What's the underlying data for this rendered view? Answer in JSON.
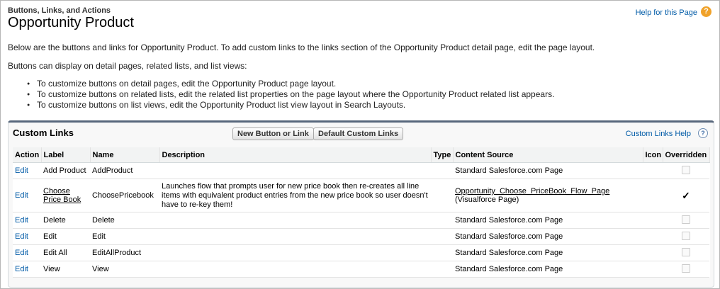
{
  "header": {
    "pretitle": "Buttons, Links, and Actions",
    "title": "Opportunity Product",
    "help_link": "Help for this Page",
    "help_icon": "?"
  },
  "intro": {
    "line1": "Below are the buttons and links for Opportunity Product. To add custom links to the links section of the Opportunity Product detail page, edit the page layout.",
    "line2": "Buttons can display on detail pages, related lists, and list views:",
    "bullets": [
      "To customize buttons on detail pages, edit the Opportunity Product page layout.",
      "To customize buttons on related lists, edit the related list properties on the page layout where the Opportunity Product related list appears.",
      "To customize buttons on list views, edit the Opportunity Product list view layout in Search Layouts."
    ]
  },
  "panel": {
    "title": "Custom Links",
    "new_button": "New Button or Link",
    "default_button": "Default Custom Links",
    "help_link": "Custom Links Help",
    "help_icon": "?",
    "columns": [
      "Action",
      "Label",
      "Name",
      "Description",
      "Type",
      "Content Source",
      "Icon",
      "Overridden"
    ],
    "rows": [
      {
        "action": "Edit",
        "label": "Add Product",
        "name": "AddProduct",
        "description": "",
        "type": "",
        "source": "Standard Salesforce.com Page",
        "source_sub": "",
        "icon": "",
        "overridden": false
      },
      {
        "action": "Edit",
        "label": "Choose Price Book",
        "name": "ChoosePricebook",
        "description": "Launches flow that prompts user for new price book then re-creates all line items with equivalent product entries from the new price book so user doesn't have to re-key them!",
        "type": "",
        "source": "Opportunity_Choose_PriceBook_Flow_Page",
        "source_sub": "(Visualforce Page)",
        "icon": "",
        "overridden": true
      },
      {
        "action": "Edit",
        "label": "Delete",
        "name": "Delete",
        "description": "",
        "type": "",
        "source": "Standard Salesforce.com Page",
        "source_sub": "",
        "icon": "",
        "overridden": false
      },
      {
        "action": "Edit",
        "label": "Edit",
        "name": "Edit",
        "description": "",
        "type": "",
        "source": "Standard Salesforce.com Page",
        "source_sub": "",
        "icon": "",
        "overridden": false
      },
      {
        "action": "Edit",
        "label": "Edit All",
        "name": "EditAllProduct",
        "description": "",
        "type": "",
        "source": "Standard Salesforce.com Page",
        "source_sub": "",
        "icon": "",
        "overridden": false
      },
      {
        "action": "Edit",
        "label": "View",
        "name": "View",
        "description": "",
        "type": "",
        "source": "Standard Salesforce.com Page",
        "source_sub": "",
        "icon": "",
        "overridden": false
      }
    ],
    "check_glyph": "✓"
  }
}
